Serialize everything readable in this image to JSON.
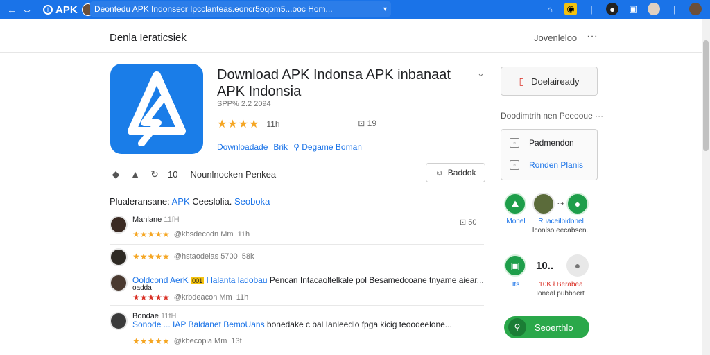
{
  "browser": {
    "brand": "APK",
    "url": "Deontedu APK Indonsecr Ipcclanteas.eoncr5oqom5...ooc Hom...",
    "icons": [
      "back-icon",
      "forward-icon",
      "info-icon",
      "profile-icon",
      "chevron-down-icon",
      "home-icon",
      "yellow-extension-icon",
      "dark-extension-icon",
      "bookmark-icon",
      "profile-avatar",
      "profile-avatar-2"
    ]
  },
  "page": {
    "header_title": "Denla Ieraticsiek",
    "header_right": "Jovenleloo",
    "header_dots": "···"
  },
  "app": {
    "title": "Download APK Indonsa APK inbanaat APK Indonsia",
    "version": "SPP% 2.2 2094",
    "rating_count": "11h",
    "side_count": "19",
    "links": [
      "Downloadade",
      "Brik",
      "Degame Boman"
    ],
    "action_count": "10",
    "action_label": "Nounlnocken Penkea",
    "button_label": "Baddok",
    "stars": 4
  },
  "section": {
    "label": "Plualeransane:",
    "blue1": "APK",
    "tail": "Ceeslolia.",
    "blue2": "Seoboka"
  },
  "reviews": [
    {
      "name": "Mahlane",
      "time": "11fH",
      "stars_text": "★★★★★",
      "meta": "@kbsdecodn Mm",
      "meta2": "11h",
      "side": "50"
    },
    {
      "name": "",
      "time": "",
      "stars_text": "★★★★★",
      "meta": "@hstaodelas 5700",
      "meta2": "58k"
    },
    {
      "name": "Ooldcond AerK",
      "badge": "001",
      "blue_text": "I lalanta ladobau",
      "text": "Pencan Intacaoltelkale pol Besamedcoane tnyame aiear...",
      "sub": "oadda",
      "stars_text": "★★★★★",
      "meta": "@krbdeacon Mm",
      "meta2": "11h"
    },
    {
      "name": "Bondae",
      "time": "11fH",
      "blue_text": "Sonode ... IAP Baldanet BemoUans",
      "text": "bonedake c bal Ianleedlo fpga kicig teoodeelone...",
      "stars_text": "★★★★★",
      "meta": "@kbecopia Mm",
      "meta2": "13t"
    }
  ],
  "sidebar": {
    "download_label": "Doelaiready",
    "title": "Doodimtrih nen Peeooue",
    "card_row1": "Padmendon",
    "card_row2": "Ronden Planis",
    "circle_label1": "Monel",
    "circle_label2": "Ruaceilbidonel",
    "circle_sub2": "Iconlso eecabsen.",
    "circle2_count": "10..",
    "circle2_label1": "Its",
    "circle2_label2": "10K ł Berabea",
    "circle2_sub": "Ioneal pubbnert",
    "green_button": "Seoerthlo"
  }
}
